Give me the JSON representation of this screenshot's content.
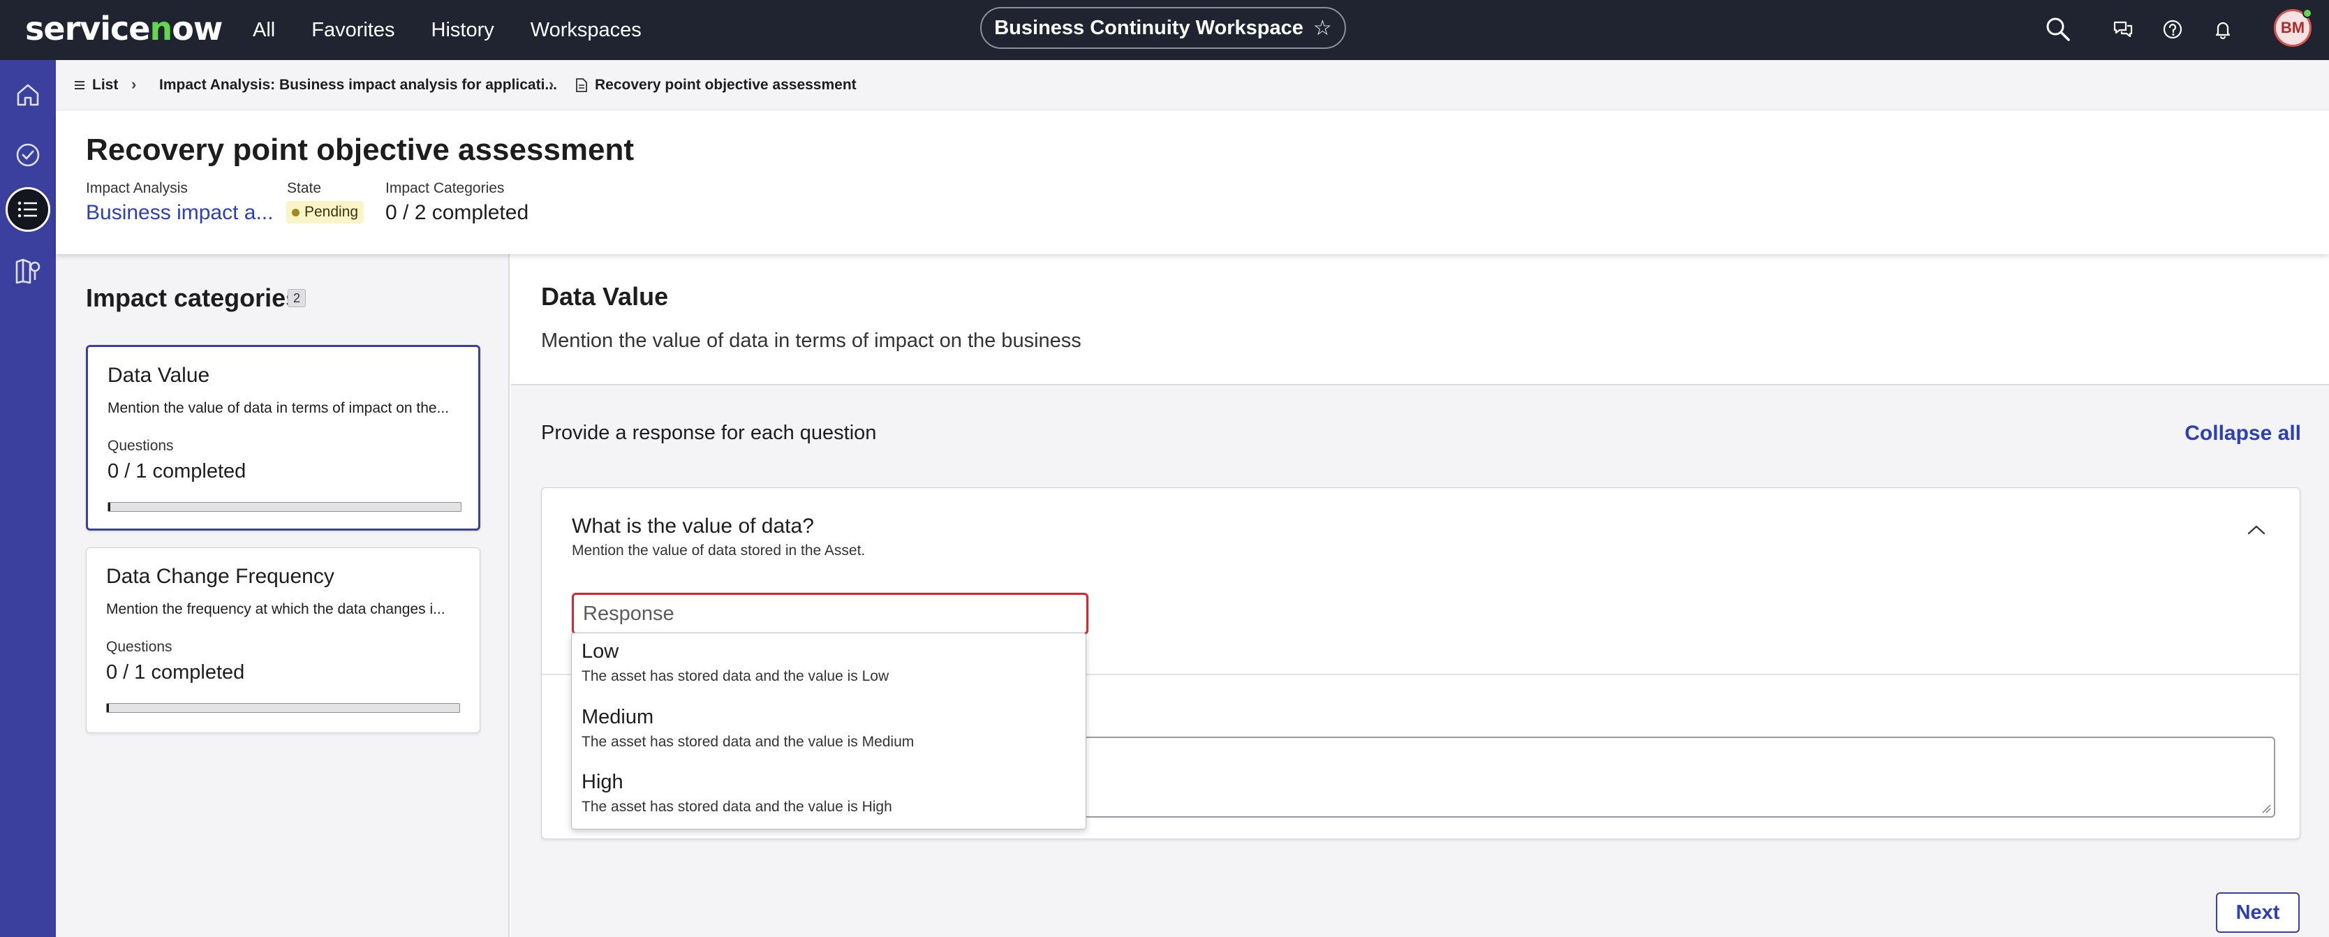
{
  "topnav": {
    "logo": "servicenow",
    "items": [
      "All",
      "Favorites",
      "History",
      "Workspaces"
    ],
    "workspace": "Business Continuity Workspace",
    "avatar_initials": "BM"
  },
  "breadcrumb": {
    "list": "List",
    "parent": "Impact Analysis: Business impact analysis for applicati...",
    "current": "Recovery point objective assessment"
  },
  "header": {
    "title": "Recovery point objective assessment",
    "impact_analysis_label": "Impact Analysis",
    "impact_analysis_value": "Business impact a...",
    "state_label": "State",
    "state_value": "Pending",
    "categories_label": "Impact Categories",
    "categories_value": "0 / 2 completed"
  },
  "categories": {
    "title": "Impact categories",
    "count": "2",
    "items": [
      {
        "title": "Data Value",
        "description": "Mention the value of data in terms of impact on the...",
        "questions_label": "Questions",
        "questions_value": "0 / 1 completed",
        "progress": 0
      },
      {
        "title": "Data Change Frequency",
        "description": "Mention the frequency at which the data changes i...",
        "questions_label": "Questions",
        "questions_value": "0 / 1 completed",
        "progress": 0
      }
    ]
  },
  "section": {
    "title": "Data Value",
    "description": "Mention the value of data in terms of impact on the business",
    "provide": "Provide a response for each question",
    "collapse_all": "Collapse all"
  },
  "question": {
    "title": "What is the value of data?",
    "help": "Mention the value of data stored in the Asset.",
    "placeholder": "Response",
    "options": [
      {
        "label": "Low",
        "description": "The asset has stored data and the value is Low"
      },
      {
        "label": "Medium",
        "description": "The asset has stored data and the value is Medium"
      },
      {
        "label": "High",
        "description": "The asset has stored data and the value is High"
      }
    ]
  },
  "footer": {
    "next": "Next"
  },
  "colors": {
    "topbar": "#1f2430",
    "rail": "#3b3f9e",
    "accent": "#2b3fb8",
    "error": "#d9262c",
    "pending": "#fbf4c8"
  }
}
